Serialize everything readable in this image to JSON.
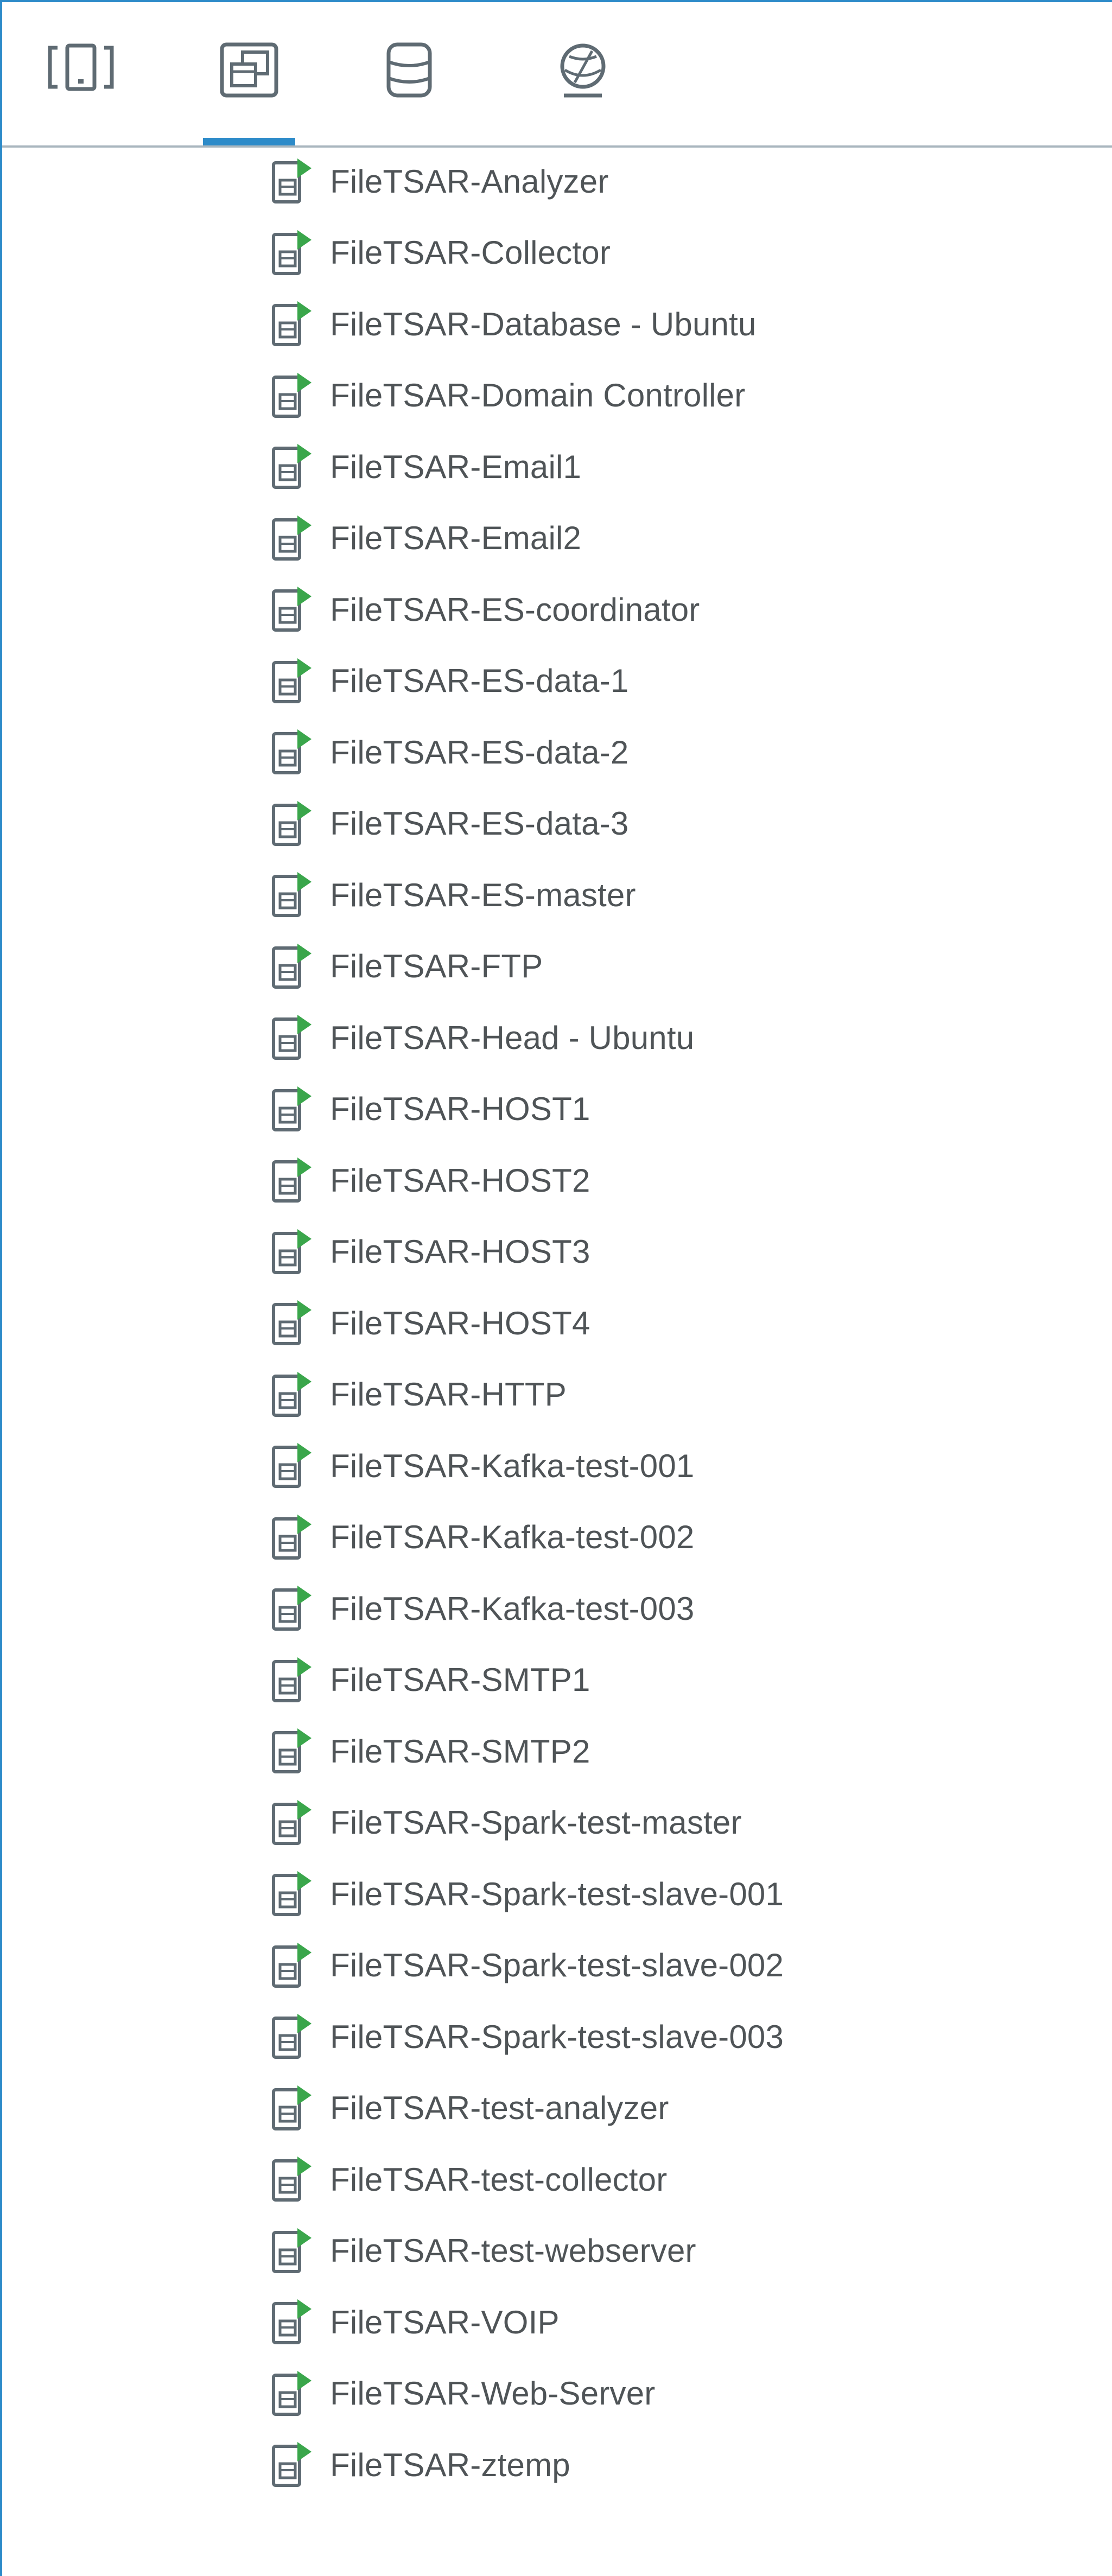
{
  "tabs": [
    {
      "icon": "hosts-clusters-icon",
      "active": false
    },
    {
      "icon": "vms-templates-icon",
      "active": true
    },
    {
      "icon": "storage-icon",
      "active": false
    },
    {
      "icon": "networking-icon",
      "active": false
    }
  ],
  "colors": {
    "accent": "#2d8bc9",
    "text": "#4f5457",
    "icon_gray": "#5f6b73",
    "icon_green": "#3aa64b"
  },
  "vms": [
    {
      "label": "FileTSAR-Analyzer"
    },
    {
      "label": "FileTSAR-Collector"
    },
    {
      "label": "FileTSAR-Database - Ubuntu"
    },
    {
      "label": "FileTSAR-Domain Controller"
    },
    {
      "label": "FileTSAR-Email1"
    },
    {
      "label": "FileTSAR-Email2"
    },
    {
      "label": "FileTSAR-ES-coordinator"
    },
    {
      "label": "FileTSAR-ES-data-1"
    },
    {
      "label": "FileTSAR-ES-data-2"
    },
    {
      "label": "FileTSAR-ES-data-3"
    },
    {
      "label": "FileTSAR-ES-master"
    },
    {
      "label": "FileTSAR-FTP"
    },
    {
      "label": "FileTSAR-Head - Ubuntu"
    },
    {
      "label": "FileTSAR-HOST1"
    },
    {
      "label": "FileTSAR-HOST2"
    },
    {
      "label": "FileTSAR-HOST3"
    },
    {
      "label": "FileTSAR-HOST4"
    },
    {
      "label": "FileTSAR-HTTP"
    },
    {
      "label": "FileTSAR-Kafka-test-001"
    },
    {
      "label": "FileTSAR-Kafka-test-002"
    },
    {
      "label": "FileTSAR-Kafka-test-003"
    },
    {
      "label": "FileTSAR-SMTP1"
    },
    {
      "label": "FileTSAR-SMTP2"
    },
    {
      "label": "FileTSAR-Spark-test-master"
    },
    {
      "label": "FileTSAR-Spark-test-slave-001"
    },
    {
      "label": "FileTSAR-Spark-test-slave-002"
    },
    {
      "label": "FileTSAR-Spark-test-slave-003"
    },
    {
      "label": "FileTSAR-test-analyzer"
    },
    {
      "label": "FileTSAR-test-collector"
    },
    {
      "label": "FileTSAR-test-webserver"
    },
    {
      "label": "FileTSAR-VOIP"
    },
    {
      "label": "FileTSAR-Web-Server"
    },
    {
      "label": "FileTSAR-ztemp"
    }
  ]
}
